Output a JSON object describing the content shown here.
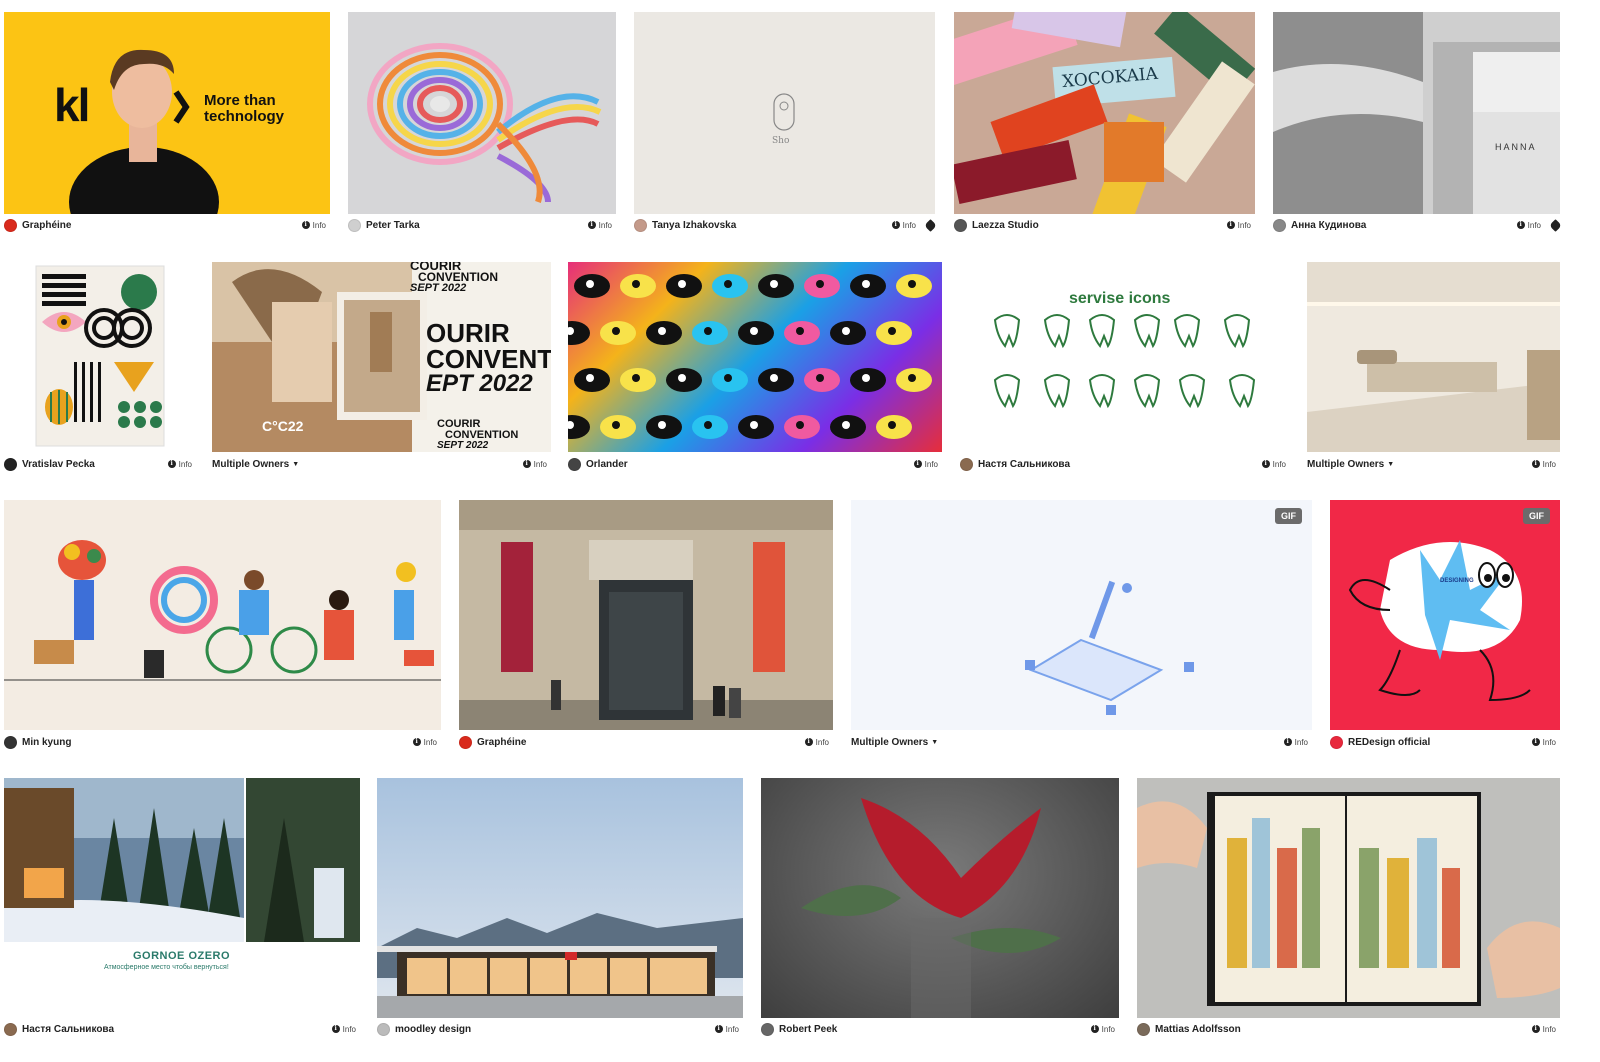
{
  "info_label": "Info",
  "gif_label": "GIF",
  "cards": [
    {
      "owner": "Graphéine",
      "avatar_color": "#d92a1c",
      "text_kl": "kl",
      "text_tagline1": "More than",
      "text_tagline2": "technology"
    },
    {
      "owner": "Peter Tarka",
      "avatar_color": "#cfcfcf"
    },
    {
      "owner": "Tanya Izhakovska",
      "avatar_color": "#c49a8a",
      "text_logo": "Sho"
    },
    {
      "owner": "Laezza Studio",
      "avatar_color": "#555555",
      "text_brand": "XOCOKAIA",
      "has_tag": false
    },
    {
      "owner": "Анна Кудинова",
      "avatar_color": "#888888",
      "text_sign": "HANNA",
      "has_tag": true
    },
    {
      "owner": "Vratislav Pecka",
      "avatar_color": "#222222"
    },
    {
      "owner": "Multiple Owners",
      "multiple": true,
      "text_poster1": "COURIR",
      "text_poster2": "CONVENTION",
      "text_poster3": "SEPT 2022",
      "text_poster4": "OURIR",
      "text_poster5": "CONVENT",
      "text_poster6": "EPT 2022",
      "text_poster7": "C°C22"
    },
    {
      "owner": "Orlander",
      "avatar_color": "#444444"
    },
    {
      "owner": "Настя Сальникова",
      "avatar_color": "#8a6a50",
      "text_heading": "servise icons"
    },
    {
      "owner": "Multiple Owners",
      "multiple": true
    },
    {
      "owner": "Min kyung",
      "avatar_color": "#333333"
    },
    {
      "owner": "Graphéine",
      "avatar_color": "#d92a1c"
    },
    {
      "owner": "Multiple Owners",
      "multiple": true,
      "gif": true
    },
    {
      "owner": "REDesign official",
      "avatar_color": "#e8283c",
      "gif": true,
      "text_bubble": "DESIGNING"
    },
    {
      "owner": "Настя Сальникова",
      "avatar_color": "#8a6a50",
      "text_title": "GORNOE OZERO",
      "text_sub": "Атмосферное место чтобы вернуться!"
    },
    {
      "owner": "moodley design",
      "avatar_color": "#bbbbbb"
    },
    {
      "owner": "Robert Peek",
      "avatar_color": "#666666"
    },
    {
      "owner": "Mattias Adolfsson",
      "avatar_color": "#7a6a5a"
    }
  ]
}
